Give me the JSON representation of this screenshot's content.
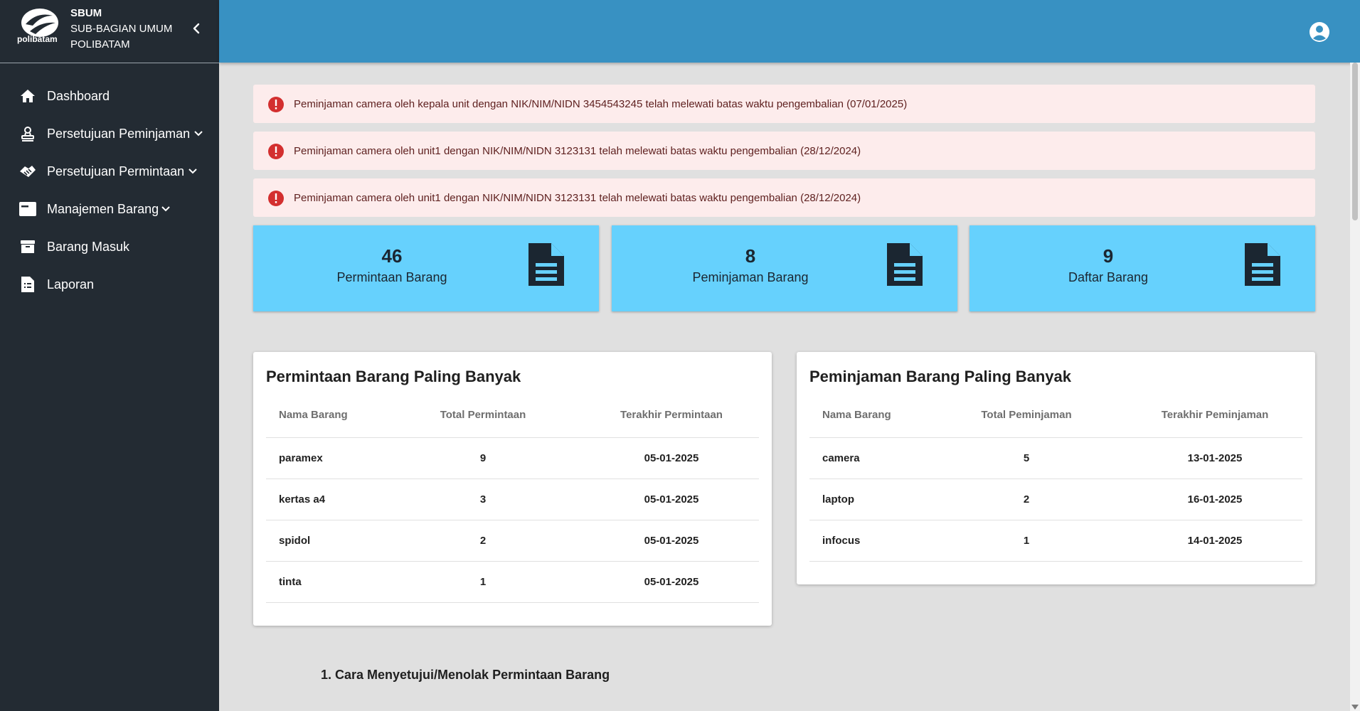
{
  "brand": {
    "logo_text": "polibatam",
    "title_line1": "SBUM",
    "title_line2": "SUB-BAGIAN UMUM",
    "title_line3": "POLIBATAM"
  },
  "sidebar": {
    "items": [
      {
        "label": "Dashboard",
        "icon": "home-icon"
      },
      {
        "label": "Persetujuan Peminjaman",
        "icon": "user-stamp-icon",
        "dropdown": true
      },
      {
        "label": "Persetujuan Permintaan",
        "icon": "handshake-icon",
        "dropdown": true
      },
      {
        "label": "Manajemen Barang",
        "icon": "card-icon",
        "dropdown": true
      },
      {
        "label": "Barang Masuk",
        "icon": "archive-box-icon"
      },
      {
        "label": "Laporan",
        "icon": "report-icon"
      }
    ]
  },
  "alerts": [
    "Peminjaman camera oleh kepala unit dengan NIK/NIM/NIDN 3454543245 telah melewati batas waktu pengembalian (07/01/2025)",
    "Peminjaman camera oleh unit1 dengan NIK/NIM/NIDN 3123131 telah melewati batas waktu pengembalian (28/12/2024)",
    "Peminjaman camera oleh unit1 dengan NIK/NIM/NIDN 3123131 telah melewati batas waktu pengembalian (28/12/2024)"
  ],
  "stats": [
    {
      "value": "46",
      "label": "Permintaan Barang"
    },
    {
      "value": "8",
      "label": "Peminjaman Barang"
    },
    {
      "value": "9",
      "label": "Daftar Barang"
    }
  ],
  "permintaan_table": {
    "title": "Permintaan Barang Paling Banyak",
    "headers": [
      "Nama Barang",
      "Total Permintaan",
      "Terakhir Permintaan"
    ],
    "rows": [
      [
        "paramex",
        "9",
        "05-01-2025"
      ],
      [
        "kertas a4",
        "3",
        "05-01-2025"
      ],
      [
        "spidol",
        "2",
        "05-01-2025"
      ],
      [
        "tinta",
        "1",
        "05-01-2025"
      ]
    ]
  },
  "peminjaman_table": {
    "title": "Peminjaman Barang Paling Banyak",
    "headers": [
      "Nama Barang",
      "Total Peminjaman",
      "Terakhir Peminjaman"
    ],
    "rows": [
      [
        "camera",
        "5",
        "13-01-2025"
      ],
      [
        "laptop",
        "2",
        "16-01-2025"
      ],
      [
        "infocus",
        "1",
        "14-01-2025"
      ]
    ]
  },
  "guide": {
    "item1": "1. Cara Menyetujui/Menolak Permintaan Barang"
  },
  "colors": {
    "sidebar_bg": "#232b33",
    "header_bg": "#3891c2",
    "stat_card_bg": "#66d1fd",
    "alert_bg": "#fdecec",
    "alert_icon": "#d32f2f"
  }
}
